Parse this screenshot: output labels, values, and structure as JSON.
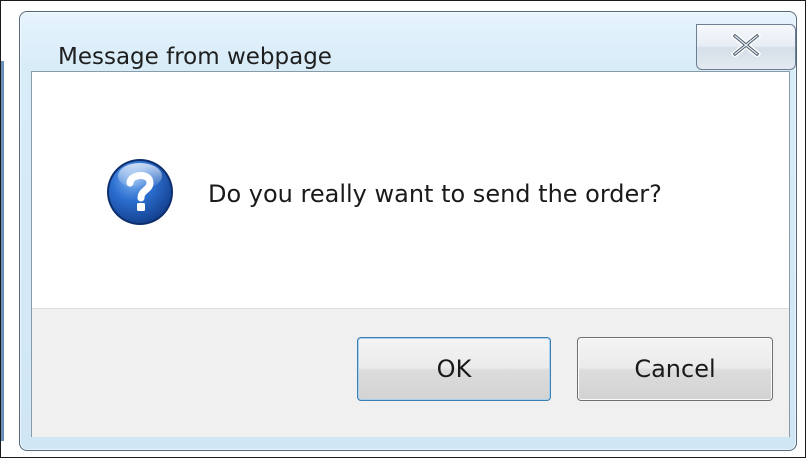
{
  "dialog": {
    "title": "Message from webpage",
    "message": "Do you really want to send the order?",
    "icon": "question-icon",
    "close_icon": "close-icon",
    "ok_label": "OK",
    "cancel_label": "Cancel"
  },
  "colors": {
    "title_bar": "#d8ecf8",
    "button_bar": "#f0f0f0",
    "icon_blue": "#1f56b0",
    "default_button_border": "#3c7fb1"
  }
}
